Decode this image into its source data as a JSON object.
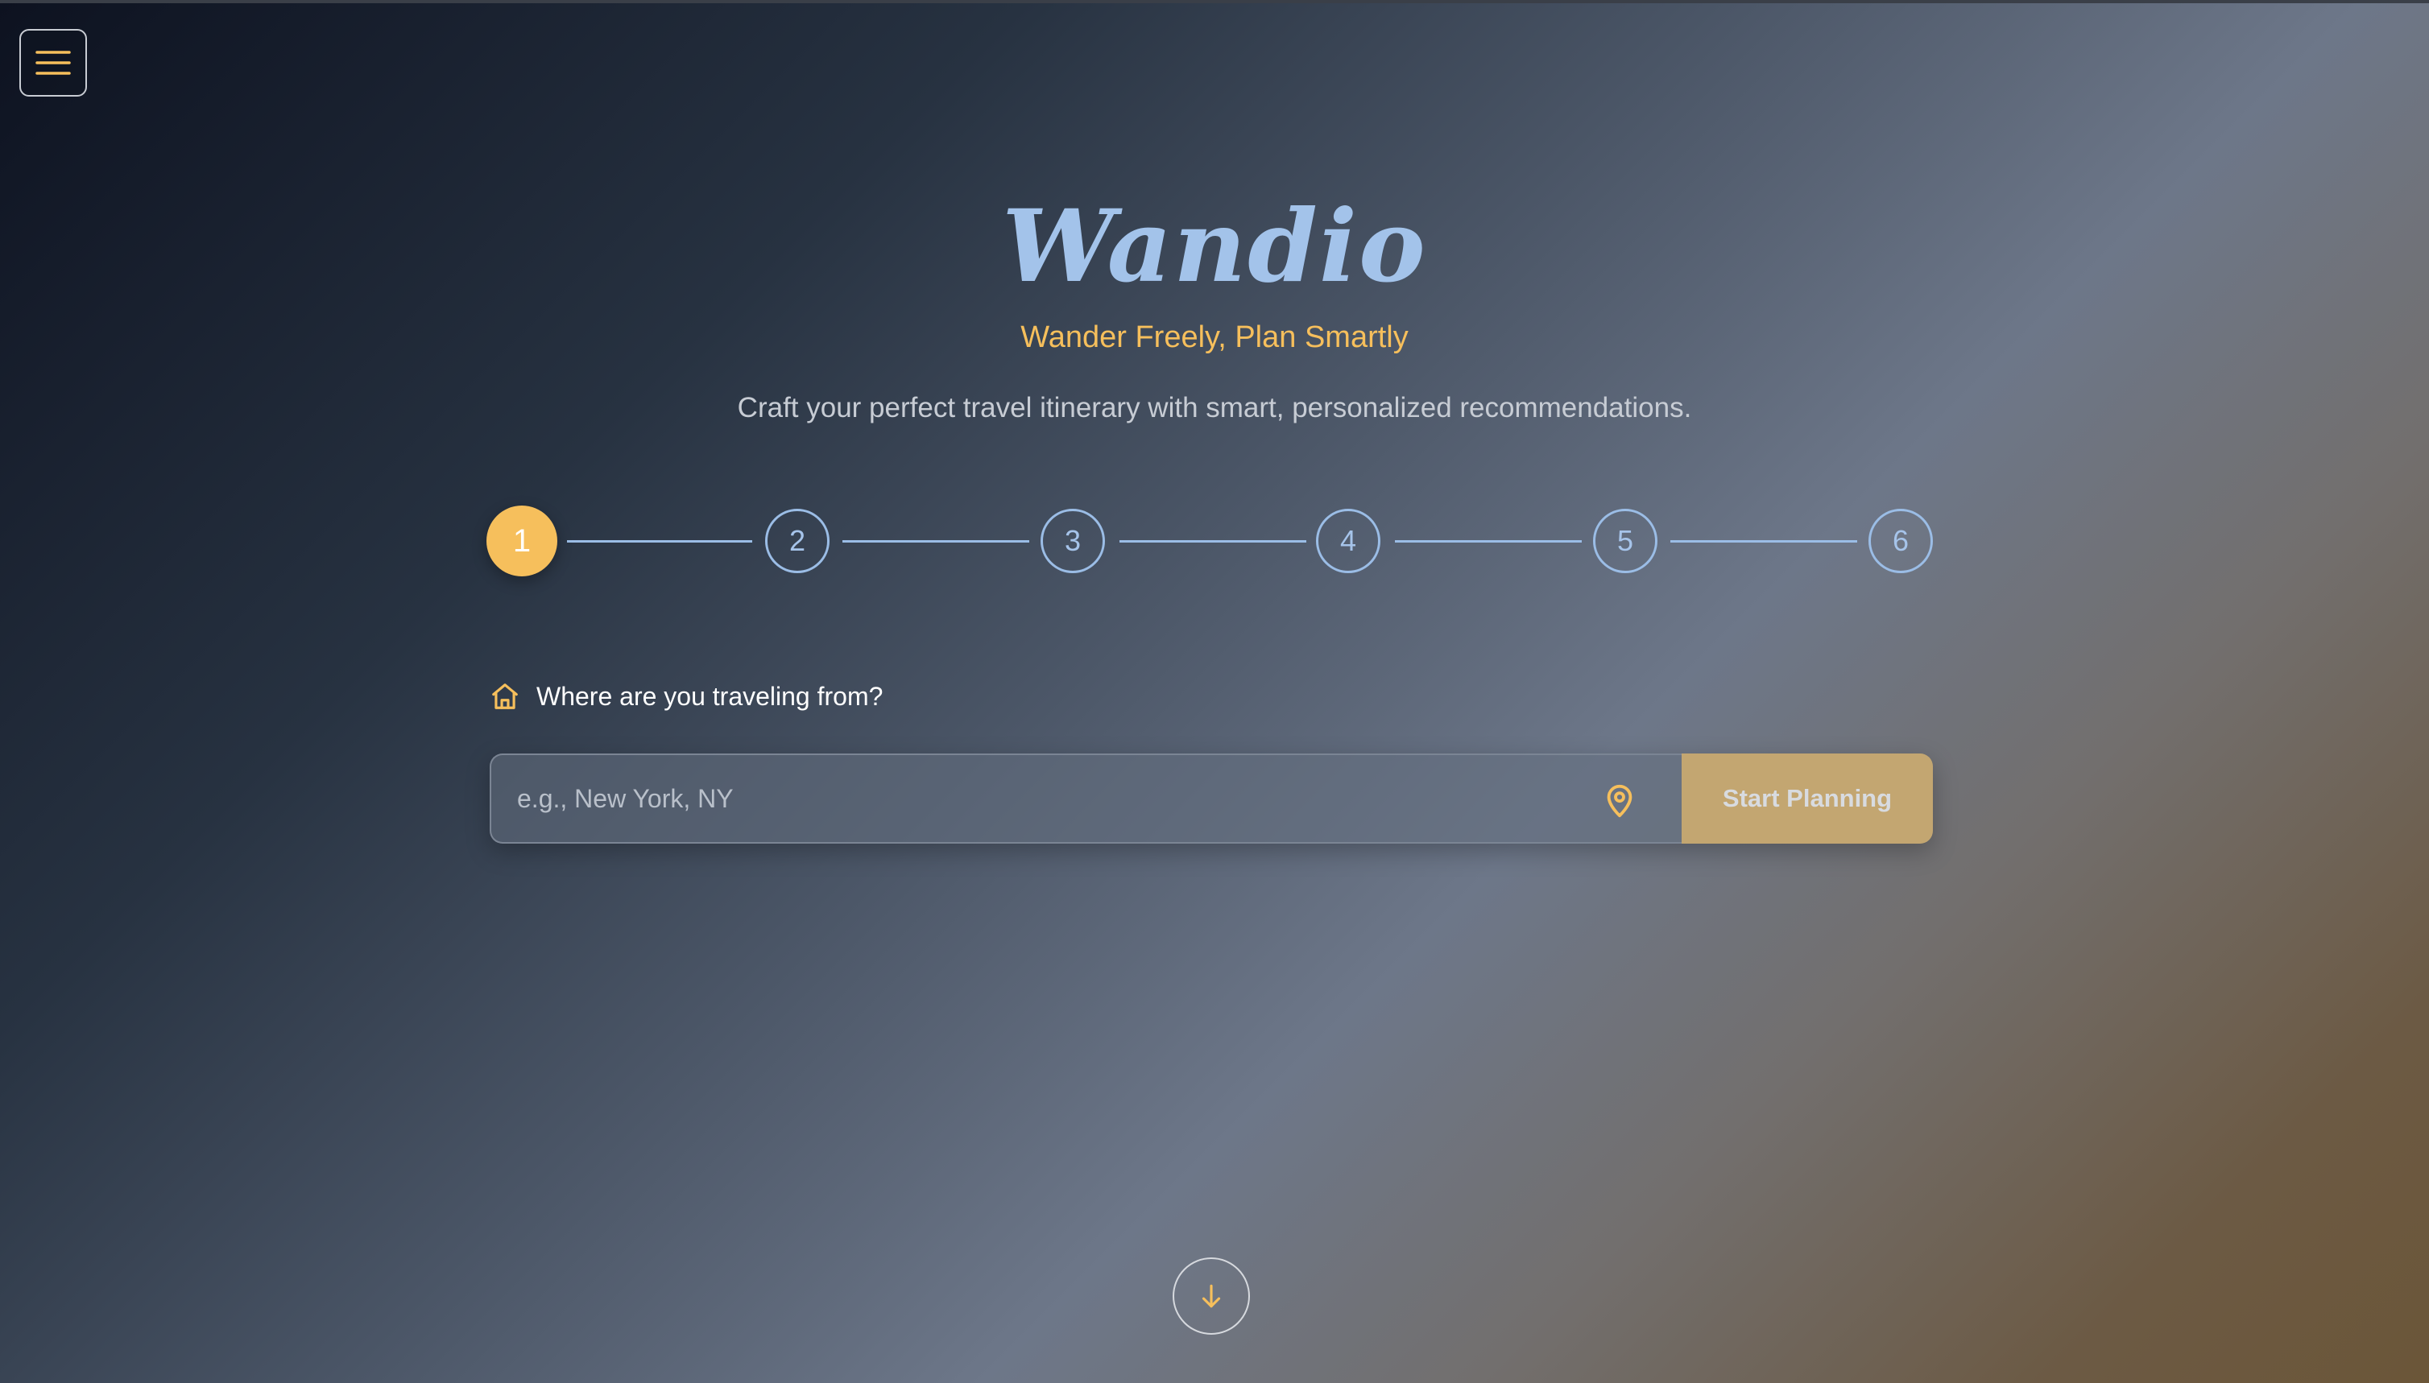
{
  "header": {
    "menu_icon": "hamburger-menu-icon"
  },
  "hero": {
    "logo": "Wandio",
    "tagline": "Wander Freely, Plan Smartly",
    "subtitle": "Craft your perfect travel itinerary with smart, personalized recommendations."
  },
  "stepper": {
    "steps": [
      "1",
      "2",
      "3",
      "4",
      "5",
      "6"
    ],
    "current_step": 1
  },
  "form": {
    "question_icon": "home-icon",
    "question": "Where are you traveling from?",
    "origin_placeholder": "e.g., New York, NY",
    "origin_value": "",
    "location_icon": "map-pin-icon",
    "submit_label": "Start Planning"
  },
  "footer": {
    "scroll_icon": "arrow-down-icon"
  },
  "colors": {
    "accent": "#f6bf5c",
    "logo": "#a3c3ea",
    "step_outline": "#9bbde6",
    "button_bg": "#c3a671"
  }
}
